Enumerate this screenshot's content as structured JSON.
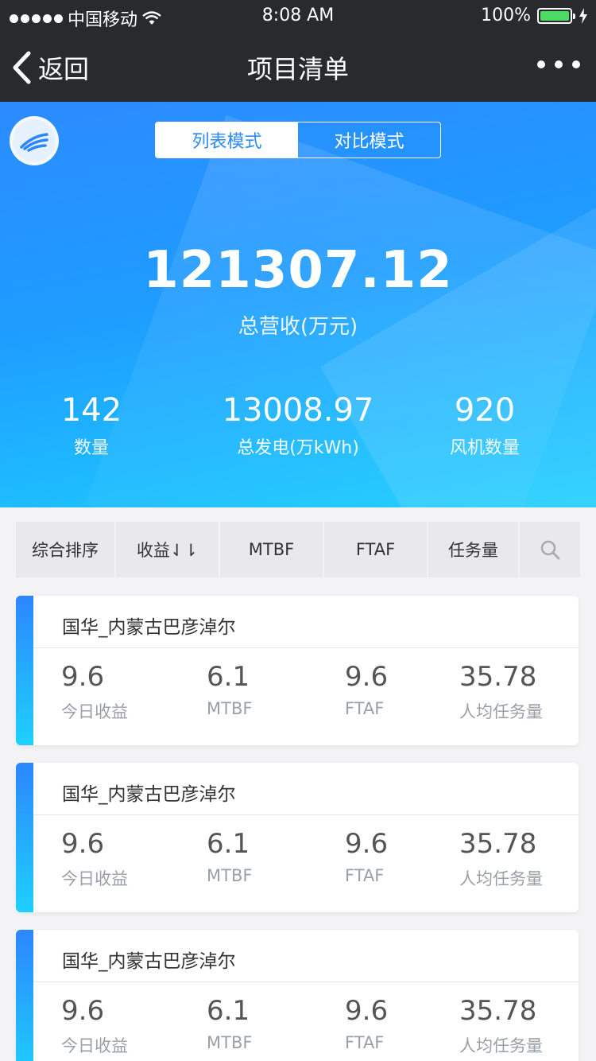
{
  "status": {
    "carrier": "中国移动",
    "time": "8:08 AM",
    "battery": "100%"
  },
  "nav": {
    "back_label": "返回",
    "title": "项目清单"
  },
  "hero": {
    "modes": [
      "列表模式",
      "对比模式"
    ],
    "total_value": "121307.12",
    "total_label": "总营收(万元)",
    "stats": [
      {
        "value": "142",
        "label": "数量"
      },
      {
        "value": "13008.97",
        "label": "总发电(万kWh)"
      },
      {
        "value": "920",
        "label": "风机数量"
      }
    ]
  },
  "sort": {
    "items": [
      "综合排序",
      "收益⇃⇂",
      "MTBF",
      "FTAF",
      "任务量"
    ]
  },
  "cards": [
    {
      "name": "国华_内蒙古巴彦淖尔",
      "metrics": [
        {
          "value": "9.6",
          "label": "今日收益"
        },
        {
          "value": "6.1",
          "label": "MTBF"
        },
        {
          "value": "9.6",
          "label": "FTAF"
        },
        {
          "value": "35.78",
          "label": "人均任务量"
        }
      ]
    },
    {
      "name": "国华_内蒙古巴彦淖尔",
      "metrics": [
        {
          "value": "9.6",
          "label": "今日收益"
        },
        {
          "value": "6.1",
          "label": "MTBF"
        },
        {
          "value": "9.6",
          "label": "FTAF"
        },
        {
          "value": "35.78",
          "label": "人均任务量"
        }
      ]
    },
    {
      "name": "国华_内蒙古巴彦淖尔",
      "metrics": [
        {
          "value": "9.6",
          "label": "今日收益"
        },
        {
          "value": "6.1",
          "label": "MTBF"
        },
        {
          "value": "9.6",
          "label": "FTAF"
        },
        {
          "value": "35.78",
          "label": "人均任务量"
        }
      ]
    }
  ]
}
